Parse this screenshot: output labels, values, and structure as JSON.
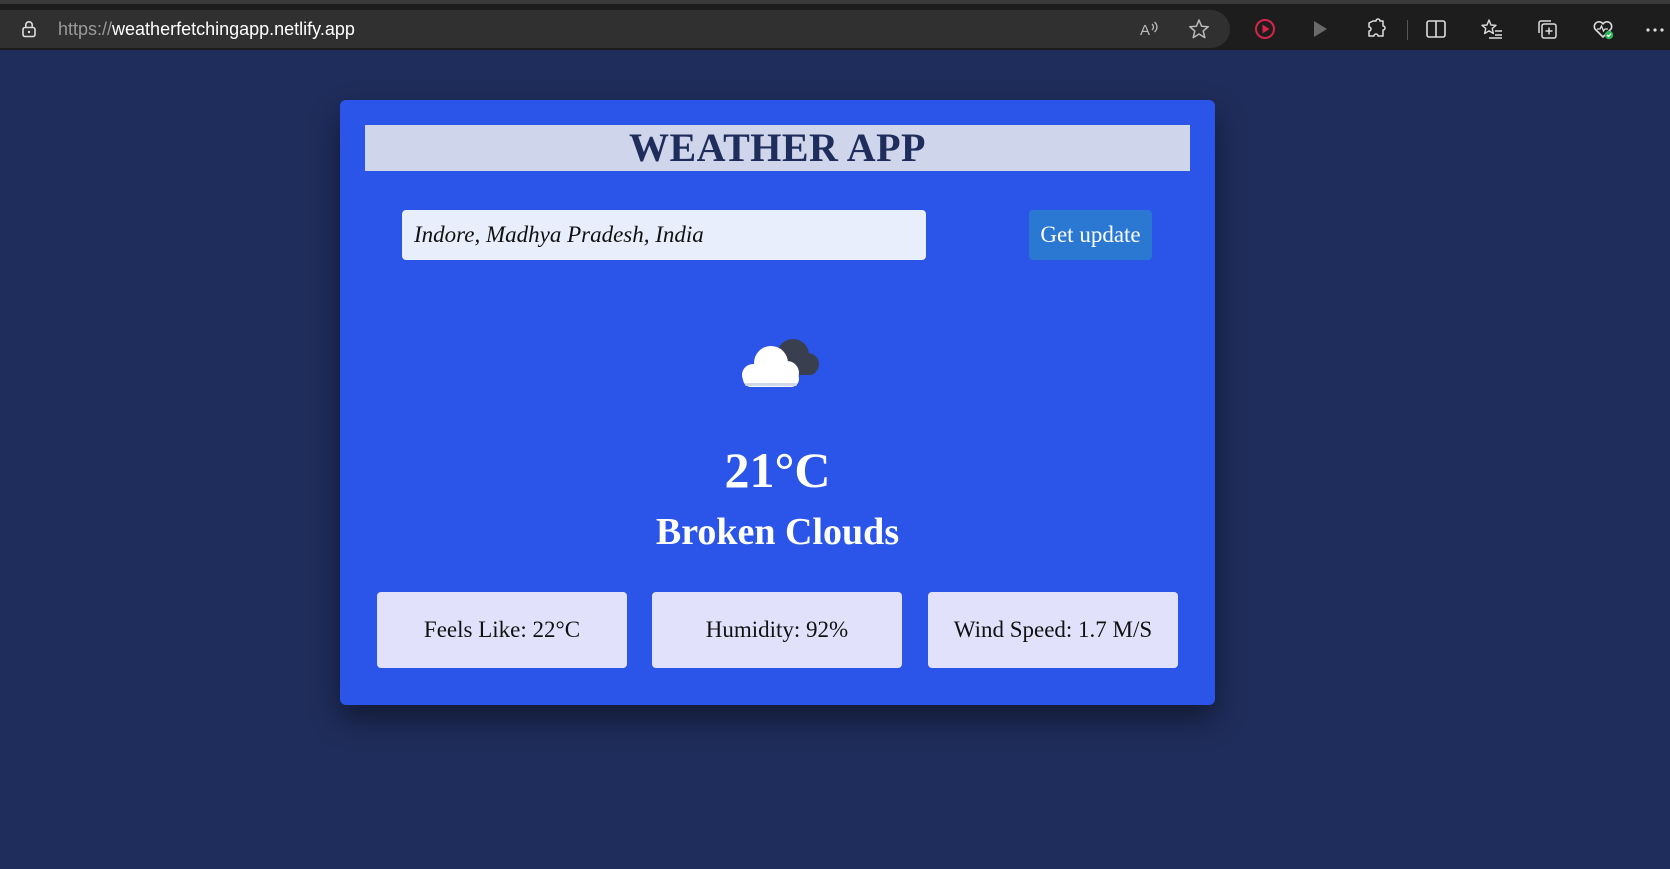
{
  "browser": {
    "url_scheme": "https://",
    "url_host": "weatherfetchingapp.netlify.app",
    "toolbar_icons": [
      "read-aloud-icon",
      "favorite-star-icon",
      "record-icon",
      "play-icon",
      "extensions-icon",
      "split-screen-icon",
      "favorites-list-icon",
      "collections-icon",
      "browser-essentials-icon",
      "more-menu-icon"
    ]
  },
  "app": {
    "title": "WEATHER APP",
    "search": {
      "value": "Indore, Madhya Pradesh, India",
      "button_label": "Get update"
    },
    "weather": {
      "icon": "broken-clouds-icon",
      "temperature": "21°C",
      "condition": "Broken Clouds"
    },
    "stats": {
      "feels_like": "Feels Like: 22°C",
      "humidity": "Humidity: 92%",
      "wind_speed": "Wind Speed: 1.7 M/S"
    }
  },
  "colors": {
    "page_background": "#1f2d5c",
    "card_background": "#2b55e8",
    "title_background": "#cfd5ea",
    "button_background": "#2a78d1",
    "stat_background": "#e2e1fc"
  }
}
